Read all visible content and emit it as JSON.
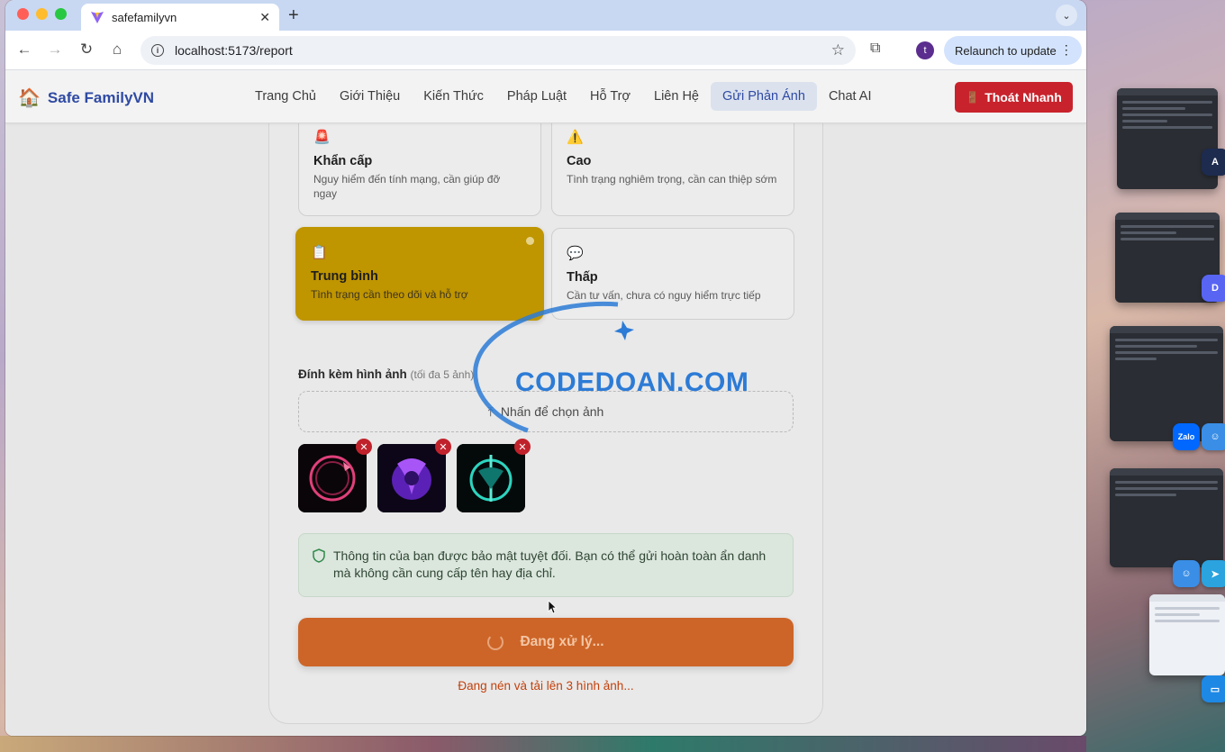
{
  "browser": {
    "tab_title": "safefamilyvn",
    "url": "localhost:5173/report",
    "relaunch_label": "Relaunch to update",
    "profile_initial": "t"
  },
  "header": {
    "brand": "Safe FamilyVN",
    "nav": [
      {
        "label": "Trang Chủ"
      },
      {
        "label": "Giới Thiệu"
      },
      {
        "label": "Kiến Thức"
      },
      {
        "label": "Pháp Luật"
      },
      {
        "label": "Hỗ Trợ"
      },
      {
        "label": "Liên Hệ"
      },
      {
        "label": "Gửi Phản Ánh",
        "active": true
      },
      {
        "label": "Chat AI"
      }
    ],
    "quick_exit": "Thoát Nhanh"
  },
  "form": {
    "priorities": [
      {
        "icon": "siren-icon",
        "title": "Khẩn cấp",
        "desc": "Nguy hiểm đến tính mạng, cần giúp đỡ ngay"
      },
      {
        "icon": "warning-icon",
        "title": "Cao",
        "desc": "Tình trạng nghiêm trọng, cần can thiệp sớm"
      },
      {
        "icon": "clipboard-icon",
        "title": "Trung bình",
        "desc": "Tình trạng cần theo dõi và hỗ trợ",
        "selected": true
      },
      {
        "icon": "speech-bubble-icon",
        "title": "Thấp",
        "desc": "Cần tư vấn, chưa có nguy hiểm trực tiếp"
      }
    ],
    "attach_label": "Đính kèm hình ảnh",
    "attach_hint": "(tối đa 5 ảnh)",
    "upload_label": "Nhấn để chọn ảnh",
    "images_count": 3,
    "privacy_notice": "Thông tin của bạn được bảo mật tuyệt đối. Bạn có thể gửi hoàn toàn ẩn danh mà không cần cung cấp tên hay địa chỉ.",
    "submit_label": "Đang xử lý...",
    "status_text": "Đang nén và tải lên 3 hình ảnh..."
  },
  "watermark": "CODEDOAN.COM",
  "dock": {
    "zalo_label": "Zalo"
  },
  "colors": {
    "brand": "#2f4aa3",
    "quick_exit": "#c8232c",
    "selected_priority": "#bf9500",
    "submit": "#cd6528",
    "status": "#c2410c"
  }
}
